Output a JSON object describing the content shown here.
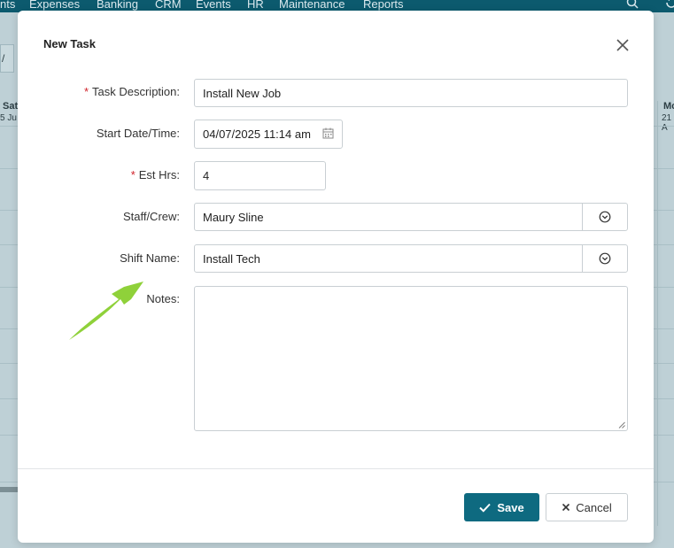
{
  "background": {
    "nav_items": [
      "nts",
      "Expenses",
      "Banking",
      "CRM",
      "Events",
      "HR",
      "Maintenance",
      "Reports"
    ],
    "toolbar_glyph": "/",
    "cal_left_day": "Sat",
    "cal_left_date": "5 Ju",
    "cal_right_day": "Mo",
    "cal_right_date": "21 A"
  },
  "modal": {
    "title": "New Task",
    "fields": {
      "task_description": {
        "label": "Task Description:",
        "required_mark": "*",
        "value": "Install New Job"
      },
      "start_datetime": {
        "label": "Start Date/Time:",
        "value": "04/07/2025 11:14 am"
      },
      "est_hrs": {
        "label": "Est Hrs:",
        "required_mark": "*",
        "value": "4"
      },
      "staff_crew": {
        "label": "Staff/Crew:",
        "value": "Maury Sline"
      },
      "shift_name": {
        "label": "Shift Name:",
        "value": "Install Tech"
      },
      "notes": {
        "label": "Notes:",
        "value": ""
      }
    },
    "buttons": {
      "save": "Save",
      "cancel": "Cancel"
    }
  },
  "colors": {
    "primary": "#0e6a80",
    "nav_bg": "#0c5a6e",
    "required": "#d0222a",
    "annotation_arrow": "#8fd13a"
  }
}
